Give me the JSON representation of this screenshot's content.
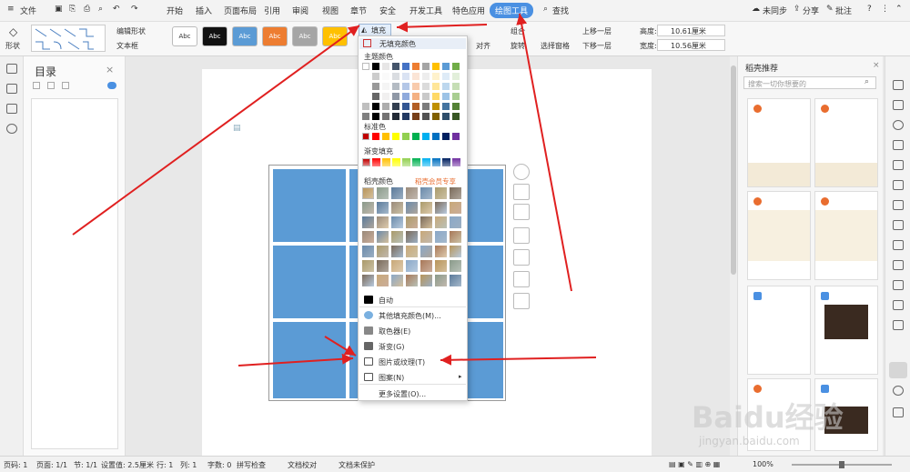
{
  "titlebar": {
    "file": "文件",
    "tabs": [
      "开始",
      "插入",
      "页面布局",
      "引用",
      "审阅",
      "视图",
      "章节",
      "安全",
      "开发工具",
      "特色应用",
      "绘图工具"
    ],
    "search": "查找",
    "sync": "未同步",
    "share": "分享",
    "annotate": "批注"
  },
  "ribbon": {
    "shape": "形状",
    "edit_shape": "编辑形状",
    "textbox": "文本框",
    "style_label": "Abc",
    "fill": "填充",
    "align": "对齐",
    "rotate": "旋转",
    "group": "组合",
    "select_pane": "选择窗格",
    "bring_forward": "上移一层",
    "send_backward": "下移一层",
    "height_label": "高度:",
    "height_value": "10.61厘米",
    "width_label": "宽度:",
    "width_value": "10.56厘米"
  },
  "toc": {
    "title": "目录"
  },
  "rpanel": {
    "title": "稻壳推荐",
    "search_placeholder": "搜索一切你想要的"
  },
  "dropdown": {
    "no_fill": "无填充颜色",
    "theme": "主题颜色",
    "standard": "标准色",
    "gradient": "渐变填充",
    "daoke": "稻壳颜色",
    "vip": "稻壳会员专享",
    "auto": "自动",
    "more_colors": "其他填充颜色(M)...",
    "eyedropper": "取色器(E)",
    "gradient_item": "渐变(G)",
    "picture": "图片或纹理(T)",
    "pattern": "图案(N)",
    "more_settings": "更多设置(O)..."
  },
  "status": {
    "page": "页码: 1",
    "pages": "页面: 1/1",
    "section": "节: 1/1",
    "setting": "设置值: 2.5厘米",
    "row": "行: 1",
    "col": "列: 1",
    "words": "字数: 0",
    "spell": "拼写检查",
    "proof": "文档校对",
    "protect": "文档未保护",
    "zoom": "100%"
  },
  "colors": {
    "accent": "#5b9bd5",
    "tab_active": "#4a90e2",
    "arrow": "#e02020"
  },
  "watermark": {
    "text": "Baidu经验",
    "url": "jingyan.baidu.com"
  }
}
